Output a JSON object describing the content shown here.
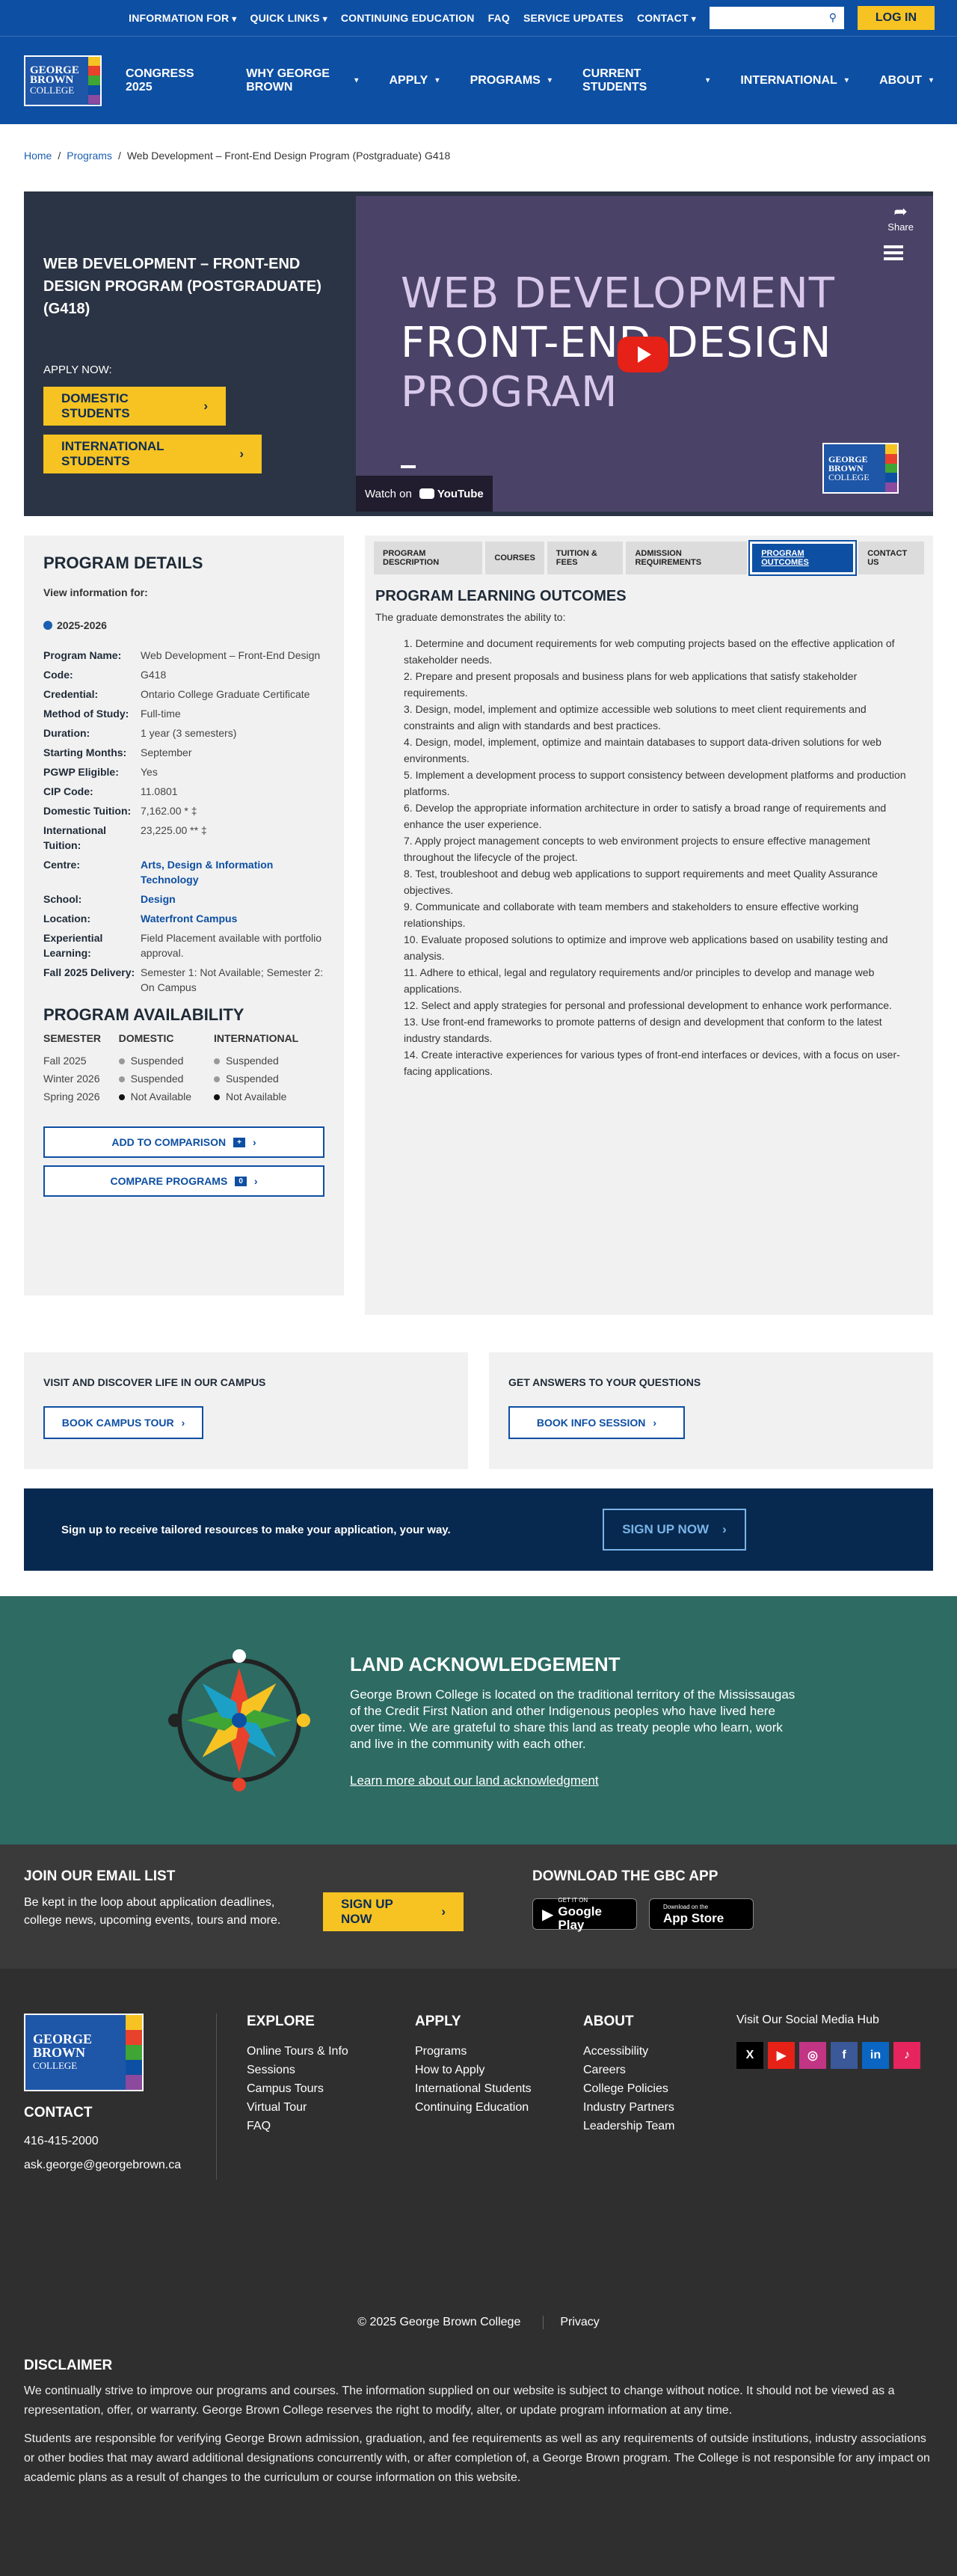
{
  "topbar": {
    "links": [
      "INFORMATION FOR",
      "QUICK LINKS",
      "CONTINUING EDUCATION",
      "FAQ",
      "SERVICE UPDATES",
      "CONTACT"
    ],
    "search_placeholder": "",
    "login": "LOG IN"
  },
  "logo": {
    "line1": "GEORGE",
    "line2": "BROWN",
    "line3": "COLLEGE"
  },
  "logo_colors": [
    "#f6c322",
    "#e8412c",
    "#3fa535",
    "#0d4fa3",
    "#8c4a9e"
  ],
  "nav": [
    "CONGRESS 2025",
    "WHY GEORGE BROWN",
    "APPLY",
    "PROGRAMS",
    "CURRENT STUDENTS",
    "INTERNATIONAL",
    "ABOUT"
  ],
  "breadcrumb": {
    "home": "Home",
    "programs": "Programs",
    "current": "Web Development – Front-End Design Program (Postgraduate) G418"
  },
  "hero": {
    "title": "WEB DEVELOPMENT – FRONT-END DESIGN PROGRAM (POSTGRADUATE) (G418)",
    "apply_now": "APPLY NOW:",
    "domestic": "DOMESTIC STUDENTS",
    "international": "INTERNATIONAL STUDENTS",
    "video_line1": "WEB DEVELOPMENT",
    "video_line2": "FRONT-END DESIGN",
    "video_line3": "PROGRAM",
    "share": "Share",
    "watch_on": "Watch on",
    "youtube": "YouTube"
  },
  "details": {
    "heading": "PROGRAM DETAILS",
    "view_for": "View information for:",
    "year": "2025-2026",
    "rows": [
      {
        "label": "Program Name:",
        "value": "Web Development – Front-End Design"
      },
      {
        "label": "Code:",
        "value": "G418"
      },
      {
        "label": "Credential:",
        "value": "Ontario College Graduate Certificate"
      },
      {
        "label": "Method of Study:",
        "value": "Full-time"
      },
      {
        "label": "Duration:",
        "value": "1 year (3 semesters)"
      },
      {
        "label": "Starting Months:",
        "value": "September"
      },
      {
        "label": "PGWP Eligible:",
        "value": "Yes"
      },
      {
        "label": "CIP Code:",
        "value": "11.0801"
      },
      {
        "label": "Domestic Tuition:",
        "value": "7,162.00 * ‡"
      },
      {
        "label": "International Tuition:",
        "value": "23,225.00 ** ‡"
      },
      {
        "label": "Centre:",
        "value": "Arts, Design & Information Technology"
      },
      {
        "label": "School:",
        "value": "Design"
      },
      {
        "label": "Location:",
        "value": "Waterfront Campus"
      },
      {
        "label": "Experiential Learning:",
        "value": "Field Placement available with portfolio approval."
      },
      {
        "label": "Fall 2025 Delivery:",
        "value": "Semester 1: Not Available; Semester 2: On Campus"
      }
    ]
  },
  "availability": {
    "heading": "PROGRAM AVAILABILITY",
    "cols": [
      "SEMESTER",
      "DOMESTIC",
      "INTERNATIONAL"
    ],
    "rows": [
      {
        "semester": "Fall 2025",
        "domestic": "Suspended",
        "international": "Suspended"
      },
      {
        "semester": "Winter 2026",
        "domestic": "Suspended",
        "international": "Suspended"
      },
      {
        "semester": "Spring 2026",
        "domestic": "Not Available",
        "international": "Not Available"
      }
    ],
    "add_compare": "ADD TO COMPARISON",
    "add_badge": "+",
    "compare": "COMPARE PROGRAMS",
    "compare_count": "0"
  },
  "tabs": [
    "PROGRAM DESCRIPTION",
    "COURSES",
    "TUITION & FEES",
    "ADMISSION REQUIREMENTS",
    "PROGRAM OUTCOMES",
    "CONTACT US"
  ],
  "outcomes": {
    "heading": "PROGRAM LEARNING OUTCOMES",
    "intro": "The graduate demonstrates the ability to:",
    "items": [
      "1. Determine and document requirements for web computing projects based on the effective application of stakeholder needs.",
      "2. Prepare and present proposals and business plans for web applications that satisfy stakeholder requirements.",
      "3. Design, model, implement and optimize accessible web solutions to meet client requirements and constraints and align with standards and best practices.",
      "4. Design, model, implement, optimize and maintain databases to support data-driven solutions for web environments.",
      "5. Implement a development process to support consistency between development platforms and production platforms.",
      "6. Develop the appropriate information architecture in order to satisfy a broad range of requirements and enhance the user experience.",
      "7. Apply project management concepts to web environment projects to ensure effective management throughout the lifecycle of the project.",
      "8. Test, troubleshoot and debug web applications to support requirements and meet Quality Assurance objectives.",
      "9. Communicate and collaborate with team members and stakeholders to ensure effective working relationships.",
      "10. Evaluate proposed solutions to optimize and improve web applications based on usability testing and analysis.",
      "11. Adhere to ethical, legal and regulatory requirements and/or principles to develop and manage web applications.",
      "12. Select and apply strategies for personal and professional development to enhance work performance.",
      "13. Use front-end frameworks to promote patterns of design and development that conform to the latest industry standards.",
      "14. Create interactive experiences for various types of front-end interfaces or devices, with a focus on user-facing applications."
    ]
  },
  "cards": {
    "tour_heading": "VISIT AND DISCOVER LIFE IN OUR CAMPUS",
    "tour_button": "BOOK CAMPUS TOUR",
    "info_heading": "GET ANSWERS TO YOUR QUESTIONS",
    "info_button": "BOOK INFO SESSION"
  },
  "signup": {
    "text": "Sign up to receive tailored resources to make your application, your way.",
    "button": "SIGN UP NOW"
  },
  "land": {
    "heading": "LAND ACKNOWLEDGEMENT",
    "text": "George Brown College is located on the traditional territory of the Mississaugas of the Credit First Nation and other Indigenous peoples who have lived here over time. We are grateful to share this land as treaty people who learn, work and live in the community with each other.",
    "link": "Learn more about our land acknowledgment"
  },
  "email": {
    "heading": "JOIN OUR EMAIL LIST",
    "text": "Be kept in the loop about application deadlines, college news, upcoming events, tours and more.",
    "button": "SIGN UP NOW"
  },
  "app": {
    "heading": "DOWNLOAD THE GBC APP",
    "google_small": "GET IT ON",
    "google": "Google Play",
    "apple_small": "Download on the",
    "apple": "App Store"
  },
  "footer": {
    "contact_heading": "CONTACT",
    "phone": "416-415-2000",
    "email": "ask.george@georgebrown.ca",
    "explore_heading": "EXPLORE",
    "explore": [
      "Online Tours & Info Sessions",
      "Campus Tours",
      "Virtual Tour",
      "FAQ"
    ],
    "apply_heading": "APPLY",
    "apply": [
      "Programs",
      "How to Apply",
      "International Students",
      "Continuing Education"
    ],
    "about_heading": "ABOUT",
    "about": [
      "Accessibility",
      "Careers",
      "College Policies",
      "Industry Partners",
      "Leadership Team"
    ],
    "social_heading": "Visit Our Social Media Hub",
    "social": [
      {
        "label": "X",
        "color": "#000000"
      },
      {
        "label": "▶",
        "color": "#e62117"
      },
      {
        "label": "◎",
        "color": "#c13584"
      },
      {
        "label": "f",
        "color": "#3b5998"
      },
      {
        "label": "in",
        "color": "#0a66c2"
      },
      {
        "label": "♪",
        "color": "#e6245d"
      }
    ],
    "copyright": "© 2025 George Brown College",
    "privacy": "Privacy",
    "disclaimer_heading": "DISCLAIMER",
    "disclaimer1": "We continually strive to improve our programs and courses. The information supplied on our website is subject to change without notice. It should not be viewed as a representation, offer, or warranty. George Brown College reserves the right to modify, alter, or update program information at any time.",
    "disclaimer2": "Students are responsible for verifying George Brown admission, graduation, and fee requirements as well as any requirements of outside institutions, industry associations or other bodies that may award additional designations concurrently with, or after completion of, a George Brown program. The College is not responsible for any impact on academic plans as a result of changes to the curriculum or course information on this website."
  }
}
